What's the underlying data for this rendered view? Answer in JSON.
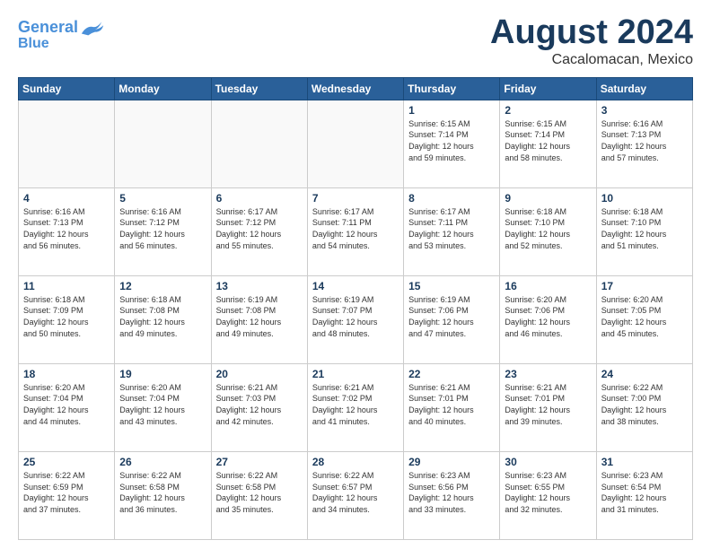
{
  "logo": {
    "line1": "General",
    "line2": "Blue"
  },
  "title": "August 2024",
  "subtitle": "Cacalomacan, Mexico",
  "days_of_week": [
    "Sunday",
    "Monday",
    "Tuesday",
    "Wednesday",
    "Thursday",
    "Friday",
    "Saturday"
  ],
  "weeks": [
    [
      {
        "day": "",
        "info": ""
      },
      {
        "day": "",
        "info": ""
      },
      {
        "day": "",
        "info": ""
      },
      {
        "day": "",
        "info": ""
      },
      {
        "day": "1",
        "info": "Sunrise: 6:15 AM\nSunset: 7:14 PM\nDaylight: 12 hours\nand 59 minutes."
      },
      {
        "day": "2",
        "info": "Sunrise: 6:15 AM\nSunset: 7:14 PM\nDaylight: 12 hours\nand 58 minutes."
      },
      {
        "day": "3",
        "info": "Sunrise: 6:16 AM\nSunset: 7:13 PM\nDaylight: 12 hours\nand 57 minutes."
      }
    ],
    [
      {
        "day": "4",
        "info": "Sunrise: 6:16 AM\nSunset: 7:13 PM\nDaylight: 12 hours\nand 56 minutes."
      },
      {
        "day": "5",
        "info": "Sunrise: 6:16 AM\nSunset: 7:12 PM\nDaylight: 12 hours\nand 56 minutes."
      },
      {
        "day": "6",
        "info": "Sunrise: 6:17 AM\nSunset: 7:12 PM\nDaylight: 12 hours\nand 55 minutes."
      },
      {
        "day": "7",
        "info": "Sunrise: 6:17 AM\nSunset: 7:11 PM\nDaylight: 12 hours\nand 54 minutes."
      },
      {
        "day": "8",
        "info": "Sunrise: 6:17 AM\nSunset: 7:11 PM\nDaylight: 12 hours\nand 53 minutes."
      },
      {
        "day": "9",
        "info": "Sunrise: 6:18 AM\nSunset: 7:10 PM\nDaylight: 12 hours\nand 52 minutes."
      },
      {
        "day": "10",
        "info": "Sunrise: 6:18 AM\nSunset: 7:10 PM\nDaylight: 12 hours\nand 51 minutes."
      }
    ],
    [
      {
        "day": "11",
        "info": "Sunrise: 6:18 AM\nSunset: 7:09 PM\nDaylight: 12 hours\nand 50 minutes."
      },
      {
        "day": "12",
        "info": "Sunrise: 6:18 AM\nSunset: 7:08 PM\nDaylight: 12 hours\nand 49 minutes."
      },
      {
        "day": "13",
        "info": "Sunrise: 6:19 AM\nSunset: 7:08 PM\nDaylight: 12 hours\nand 49 minutes."
      },
      {
        "day": "14",
        "info": "Sunrise: 6:19 AM\nSunset: 7:07 PM\nDaylight: 12 hours\nand 48 minutes."
      },
      {
        "day": "15",
        "info": "Sunrise: 6:19 AM\nSunset: 7:06 PM\nDaylight: 12 hours\nand 47 minutes."
      },
      {
        "day": "16",
        "info": "Sunrise: 6:20 AM\nSunset: 7:06 PM\nDaylight: 12 hours\nand 46 minutes."
      },
      {
        "day": "17",
        "info": "Sunrise: 6:20 AM\nSunset: 7:05 PM\nDaylight: 12 hours\nand 45 minutes."
      }
    ],
    [
      {
        "day": "18",
        "info": "Sunrise: 6:20 AM\nSunset: 7:04 PM\nDaylight: 12 hours\nand 44 minutes."
      },
      {
        "day": "19",
        "info": "Sunrise: 6:20 AM\nSunset: 7:04 PM\nDaylight: 12 hours\nand 43 minutes."
      },
      {
        "day": "20",
        "info": "Sunrise: 6:21 AM\nSunset: 7:03 PM\nDaylight: 12 hours\nand 42 minutes."
      },
      {
        "day": "21",
        "info": "Sunrise: 6:21 AM\nSunset: 7:02 PM\nDaylight: 12 hours\nand 41 minutes."
      },
      {
        "day": "22",
        "info": "Sunrise: 6:21 AM\nSunset: 7:01 PM\nDaylight: 12 hours\nand 40 minutes."
      },
      {
        "day": "23",
        "info": "Sunrise: 6:21 AM\nSunset: 7:01 PM\nDaylight: 12 hours\nand 39 minutes."
      },
      {
        "day": "24",
        "info": "Sunrise: 6:22 AM\nSunset: 7:00 PM\nDaylight: 12 hours\nand 38 minutes."
      }
    ],
    [
      {
        "day": "25",
        "info": "Sunrise: 6:22 AM\nSunset: 6:59 PM\nDaylight: 12 hours\nand 37 minutes."
      },
      {
        "day": "26",
        "info": "Sunrise: 6:22 AM\nSunset: 6:58 PM\nDaylight: 12 hours\nand 36 minutes."
      },
      {
        "day": "27",
        "info": "Sunrise: 6:22 AM\nSunset: 6:58 PM\nDaylight: 12 hours\nand 35 minutes."
      },
      {
        "day": "28",
        "info": "Sunrise: 6:22 AM\nSunset: 6:57 PM\nDaylight: 12 hours\nand 34 minutes."
      },
      {
        "day": "29",
        "info": "Sunrise: 6:23 AM\nSunset: 6:56 PM\nDaylight: 12 hours\nand 33 minutes."
      },
      {
        "day": "30",
        "info": "Sunrise: 6:23 AM\nSunset: 6:55 PM\nDaylight: 12 hours\nand 32 minutes."
      },
      {
        "day": "31",
        "info": "Sunrise: 6:23 AM\nSunset: 6:54 PM\nDaylight: 12 hours\nand 31 minutes."
      }
    ]
  ]
}
